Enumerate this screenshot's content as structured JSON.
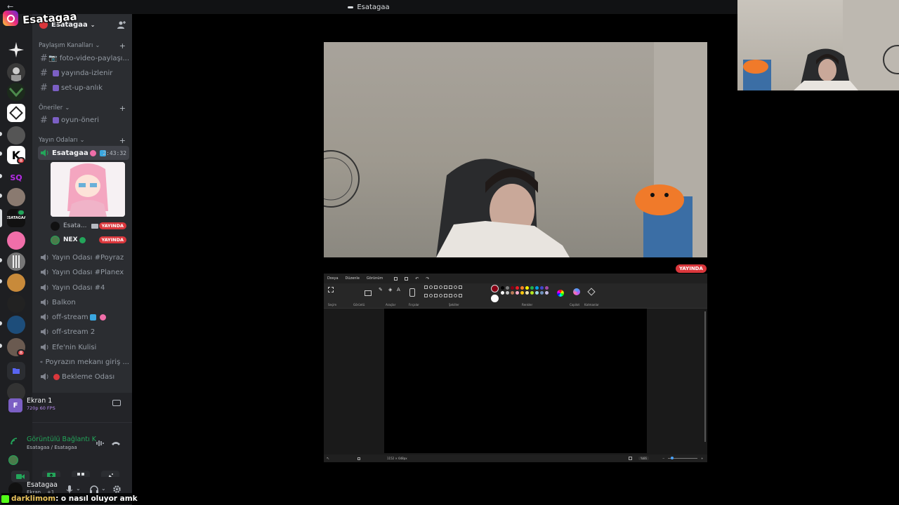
{
  "window": {
    "title": "Esatagaa"
  },
  "overlay": {
    "instagram_handle": "Esatagaa",
    "chat": {
      "nick": "darklimom",
      "message": ": o nasıl oluyor amk"
    }
  },
  "server_rail": {
    "badges": [
      "8",
      "8"
    ],
    "labels": [
      "SQ",
      "ESATAGAA"
    ]
  },
  "guild": {
    "name": "Esatagaa"
  },
  "categories": [
    {
      "name": "Paylaşım Kanalları",
      "channels": [
        {
          "name": "📷 foto-video-paylaşı..."
        },
        {
          "name": "yayında-izlenir"
        },
        {
          "name": "set-up-anlık"
        }
      ]
    },
    {
      "name": "Öneriler",
      "channels": [
        {
          "name": "oyun-öneri"
        }
      ]
    },
    {
      "name": "Yayın Odaları",
      "voice": [
        {
          "name": "Esatagaa",
          "timer": "2:43:32"
        },
        {
          "name": "Yayın Odası #Poyraz"
        },
        {
          "name": "Yayın Odası #Planex"
        },
        {
          "name": "Yayın Odası #4"
        },
        {
          "name": "Balkon"
        },
        {
          "name": "off-stream"
        },
        {
          "name": "off-stream 2"
        },
        {
          "name": "Efe'nin Kulisi"
        },
        {
          "name": "Poyrazın mekanı giriş ..."
        },
        {
          "name": "Bekleme Odası"
        }
      ]
    }
  ],
  "voice_members": [
    {
      "name": "Esata...",
      "live_label": "YAYINDA"
    },
    {
      "name": "NEX",
      "live_label": "YAYINDA"
    }
  ],
  "screen_share": {
    "title": "Ekran 1",
    "quality": "720p 60 FPS"
  },
  "voice_status": {
    "title": "Görüntülü Bağlantı K",
    "subtitle": "Esatagaa / Esatagaa"
  },
  "user": {
    "name": "Esatagaa",
    "status": "Ekran... +1"
  },
  "stage": {
    "live_label": "YAYINDA"
  },
  "paint": {
    "menu": [
      "Dosya",
      "Düzenle",
      "Görünüm"
    ],
    "ribbon_labels": [
      "Seçim",
      "Görüntü",
      "Araçlar",
      "Fırçalar",
      "Şekiller",
      "Renkler",
      "Copilot",
      "Katmanlar"
    ],
    "status_size": "1152 × 648px",
    "zoom": "%66",
    "colors": [
      "#000000",
      "#7f7f7f",
      "#880015",
      "#ed1c24",
      "#ff7f27",
      "#fff200",
      "#22b14c",
      "#00a2e8",
      "#3f48cc",
      "#a349a4",
      "#ffffff",
      "#c3c3c3",
      "#b97a57",
      "#ffaec9",
      "#ffc90e",
      "#efe4b0",
      "#b5e61d",
      "#99d9ea",
      "#7092be",
      "#c8bfe7"
    ]
  }
}
